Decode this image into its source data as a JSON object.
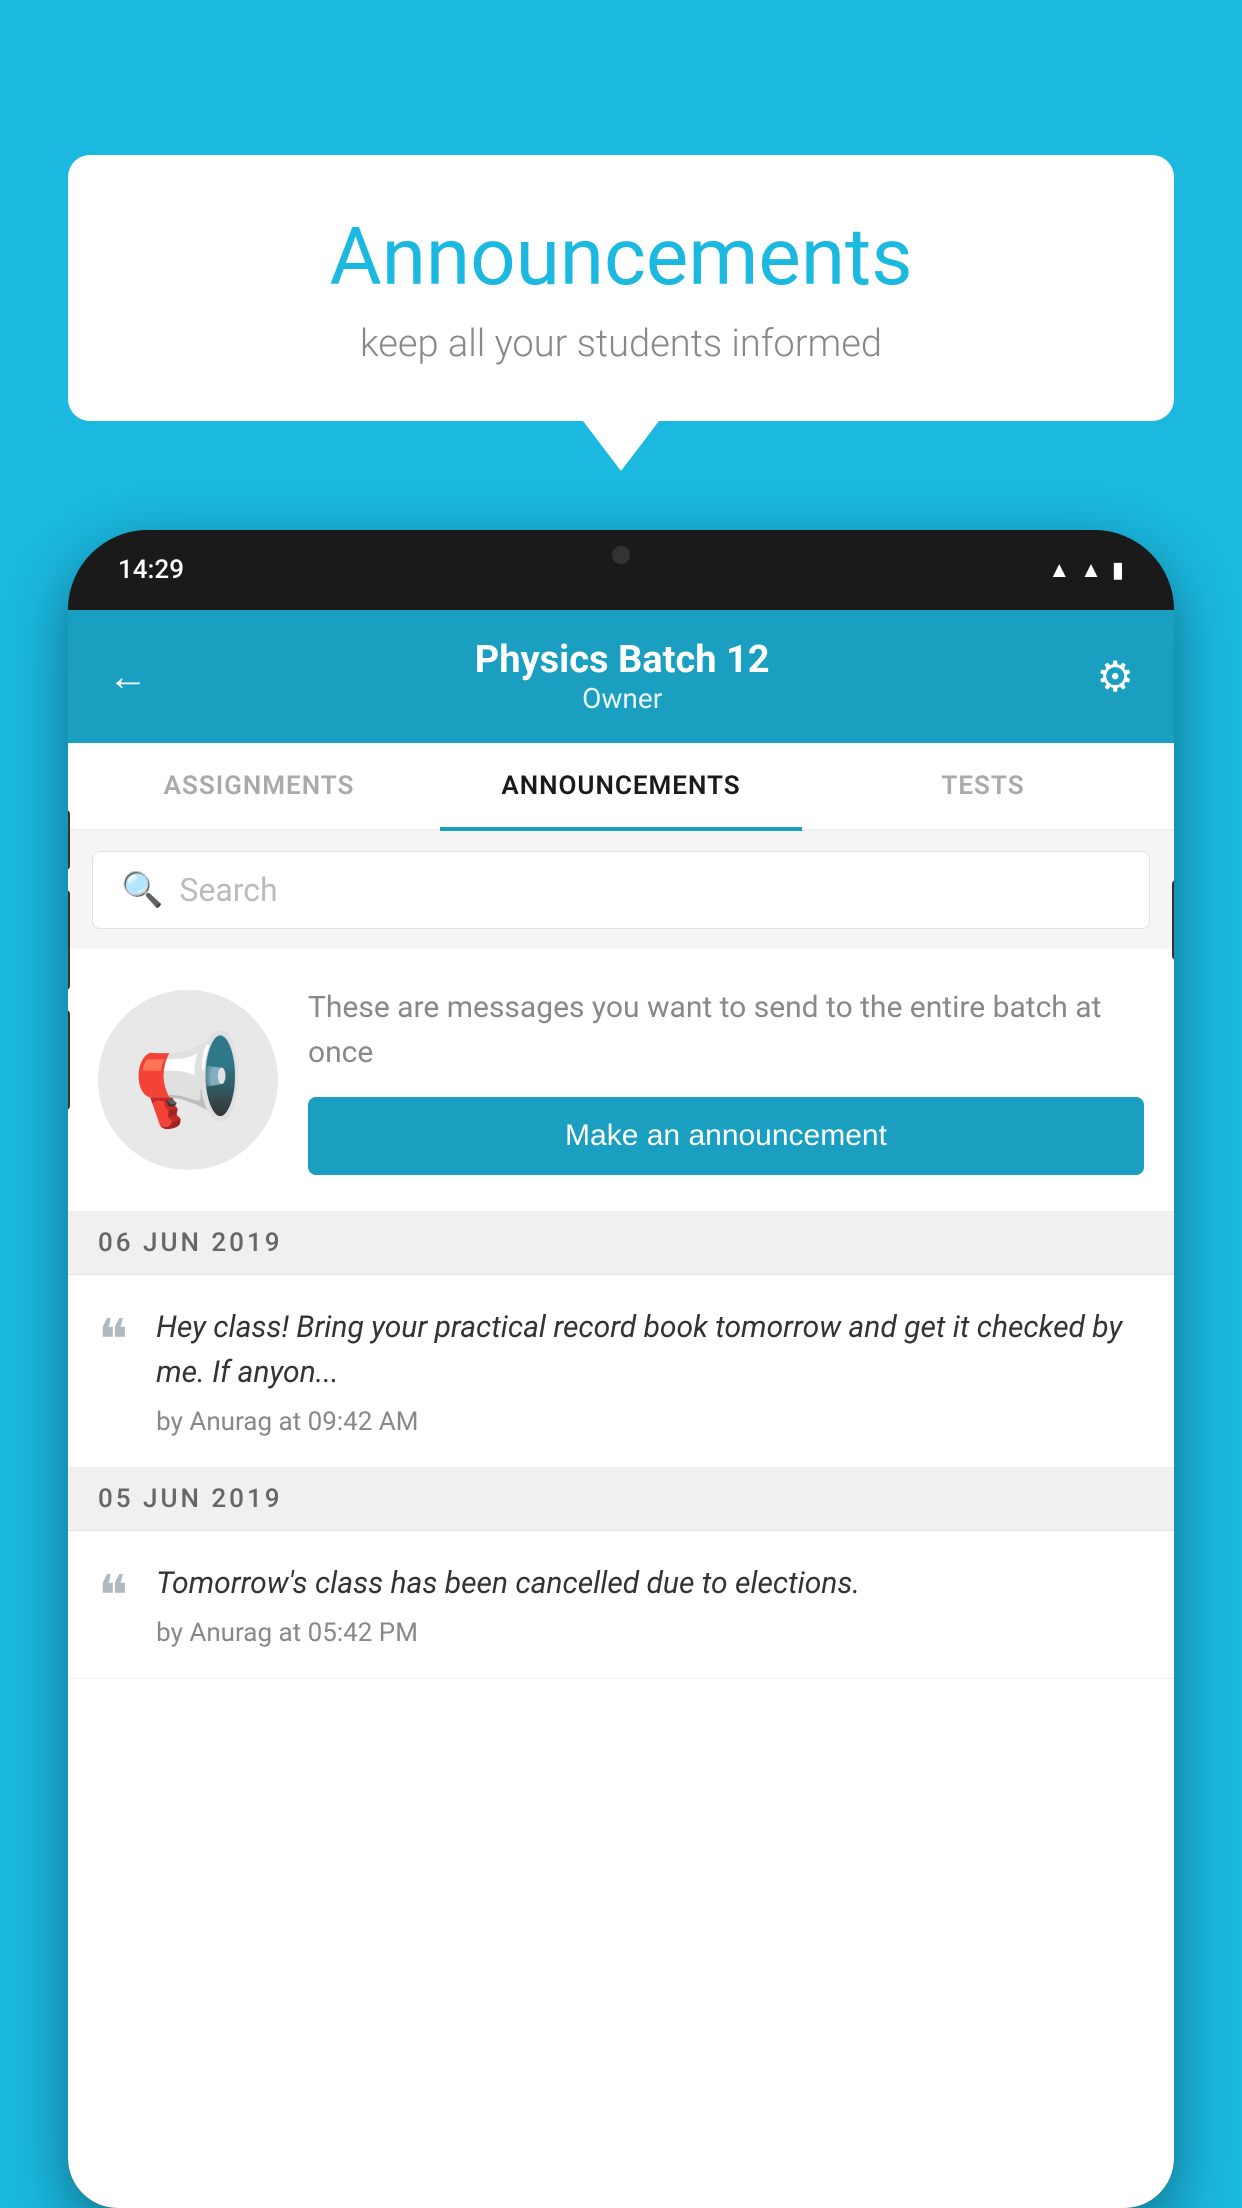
{
  "background_color": "#1bb8e0",
  "speech_bubble": {
    "title": "Announcements",
    "subtitle": "keep all your students informed"
  },
  "phone": {
    "status_bar": {
      "time": "14:29",
      "icons": [
        "wifi",
        "signal",
        "battery"
      ]
    },
    "header": {
      "back_label": "←",
      "title": "Physics Batch 12",
      "subtitle": "Owner",
      "gear_label": "⚙"
    },
    "tabs": [
      {
        "label": "ASSIGNMENTS",
        "active": false
      },
      {
        "label": "ANNOUNCEMENTS",
        "active": true
      },
      {
        "label": "TESTS",
        "active": false
      }
    ],
    "search": {
      "placeholder": "Search"
    },
    "announcement_prompt": {
      "description": "These are messages you want to send to the entire batch at once",
      "button_label": "Make an announcement"
    },
    "messages": [
      {
        "date": "06  JUN  2019",
        "text": "Hey class! Bring your practical record book tomorrow and get it checked by me. If anyon...",
        "meta": "by Anurag at 09:42 AM"
      },
      {
        "date": "05  JUN  2019",
        "text": "Tomorrow's class has been cancelled due to elections.",
        "meta": "by Anurag at 05:42 PM"
      }
    ]
  }
}
